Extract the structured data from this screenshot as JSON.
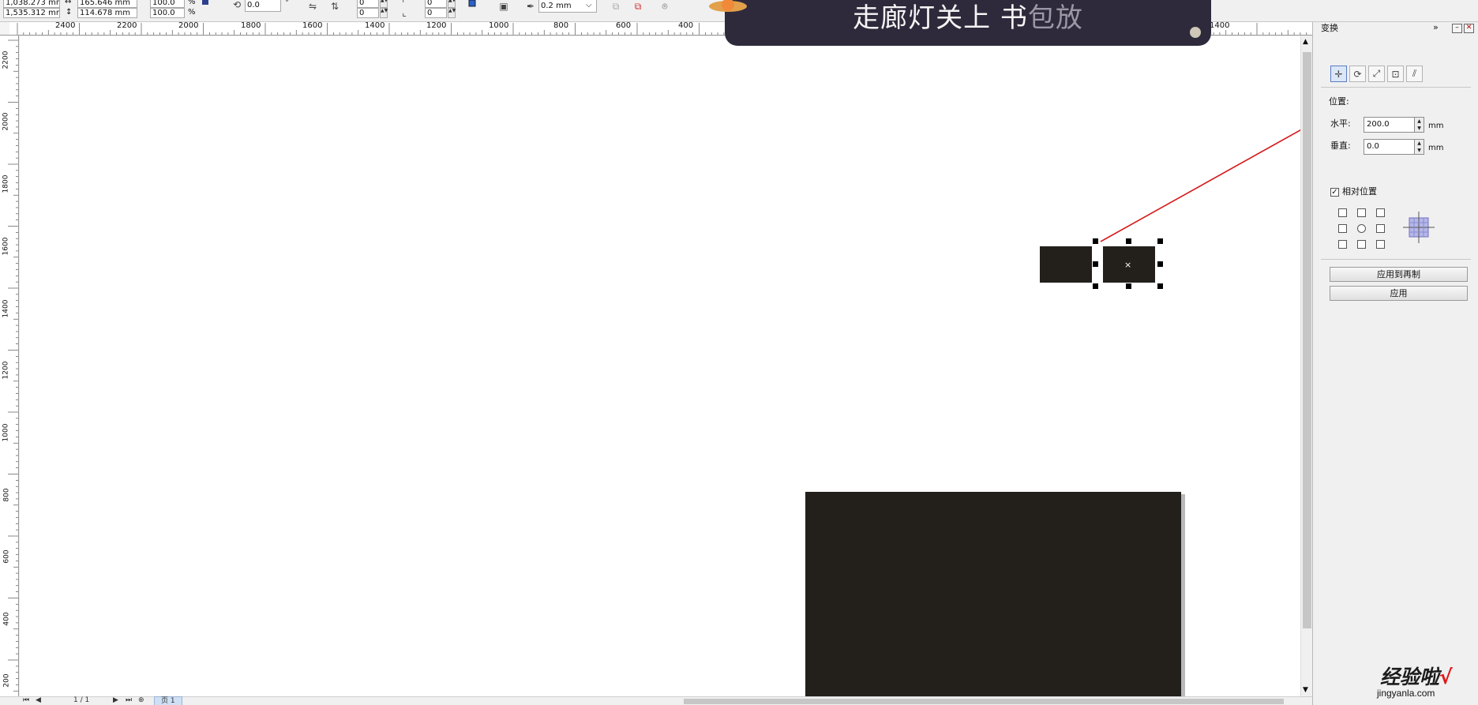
{
  "propbar": {
    "pos_x": "1,038.273 mm",
    "pos_y": "1,535.312 mm",
    "size_w": "165.646 mm",
    "size_h": "114.678 mm",
    "scale_x": "100.0",
    "scale_y": "100.0",
    "scale_unit_x": "%",
    "scale_unit_y": "%",
    "rotation": "0.0",
    "rotation_unit": "°",
    "corner_a1": "0",
    "corner_a2": "0",
    "corner_b1": "0",
    "corner_b2": "0",
    "outline_width": "0.2 mm"
  },
  "rulers": {
    "h_ticks": [
      "2400",
      "2200",
      "2000",
      "1800",
      "1600",
      "1400",
      "1200",
      "1000",
      "800",
      "600",
      "400",
      "1400"
    ],
    "v_ticks": [
      "2200",
      "2000",
      "1800",
      "1600",
      "1400",
      "1200",
      "1000",
      "800",
      "600",
      "400",
      "200"
    ]
  },
  "banner": {
    "title_main": "走廊灯关上 书",
    "title_dim": "包放"
  },
  "docker": {
    "title": "变换",
    "position_label": "位置:",
    "horizontal_label": "水平:",
    "horizontal_value": "200.0",
    "vertical_label": "垂直:",
    "vertical_value": "0.0",
    "unit": "mm",
    "relative_position_label": "相对位置",
    "relative_position_checked": true,
    "apply_to_duplicate": "应用到再制",
    "apply": "应用"
  },
  "pagebar": {
    "page_counter": "1 / 1",
    "page_tab": "页 1"
  },
  "watermark": {
    "main": "经验啦",
    "check": "√",
    "sub": "jingyanla.com"
  },
  "colors": {
    "shape_fill": "#23201c",
    "annotation_arrow": "#d61a1a",
    "banner_bg": "#2f2a3b"
  }
}
